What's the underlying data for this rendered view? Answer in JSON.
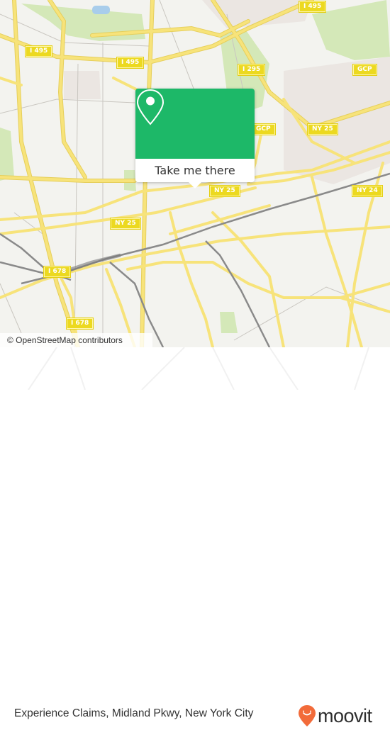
{
  "map": {
    "road_labels": [
      {
        "id": "i495-top",
        "text": "I 495"
      },
      {
        "id": "i495-left",
        "text": "I 495"
      },
      {
        "id": "i495-mid",
        "text": "I 495"
      },
      {
        "id": "i295",
        "text": "I 295"
      },
      {
        "id": "gcp-right",
        "text": "GCP"
      },
      {
        "id": "gcp-mid",
        "text": "GCP"
      },
      {
        "id": "ny25-right",
        "text": "NY 25"
      },
      {
        "id": "ny25-center",
        "text": "NY 25"
      },
      {
        "id": "ny25-left",
        "text": "NY 25"
      },
      {
        "id": "ny24",
        "text": "NY 24"
      },
      {
        "id": "i678-upper",
        "text": "I 678"
      },
      {
        "id": "i678-lower",
        "text": "I 678"
      }
    ],
    "attribution": "© OpenStreetMap contributors",
    "colors": {
      "background": "#f3f3ef",
      "road": "#f7e37a",
      "road_casing": "#e6cf5c",
      "park": "#d4e8b8",
      "rail": "#8a8a8a",
      "shield": "#ecd920"
    }
  },
  "popup": {
    "icon": "map-pin-icon",
    "action_label": "Take me there",
    "color": "#1db868"
  },
  "footer": {
    "caption": "Experience Claims, Midland Pkwy, New York City",
    "brand": "moovit",
    "brand_icon": "moovit-pin-smile-icon",
    "brand_color": "#f26b3a"
  }
}
